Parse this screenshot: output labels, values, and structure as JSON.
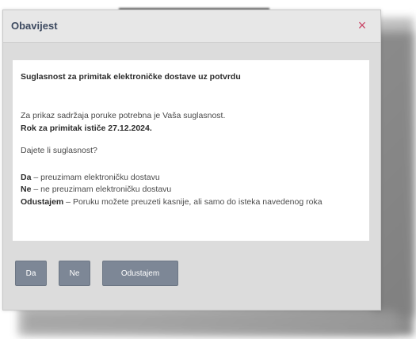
{
  "dialog": {
    "title": "Obavijest",
    "close_glyph": "×",
    "heading": "Suglasnost za primitak elektroničke dostave uz potvrdu",
    "intro": "Za prikaz sadržaja poruke potrebna je Vaša suglasnost.",
    "deadline": "Rok za primitak ističe 27.12.2024.",
    "question": "Dajete li suglasnost?",
    "options": [
      {
        "key": "Da",
        "desc": " – preuzimam elektroničku dostavu"
      },
      {
        "key": "Ne",
        "desc": " – ne preuzimam elektroničku dostavu"
      },
      {
        "key": "Odustajem",
        "desc": " – Poruku možete preuzeti kasnije, ali samo do isteka navedenog roka"
      }
    ],
    "buttons": {
      "yes": "Da",
      "no": "Ne",
      "cancel": "Odustajem"
    }
  },
  "colors": {
    "accent_close": "#c94868",
    "button_bg": "#7d8796",
    "title_text": "#3d4a60"
  }
}
